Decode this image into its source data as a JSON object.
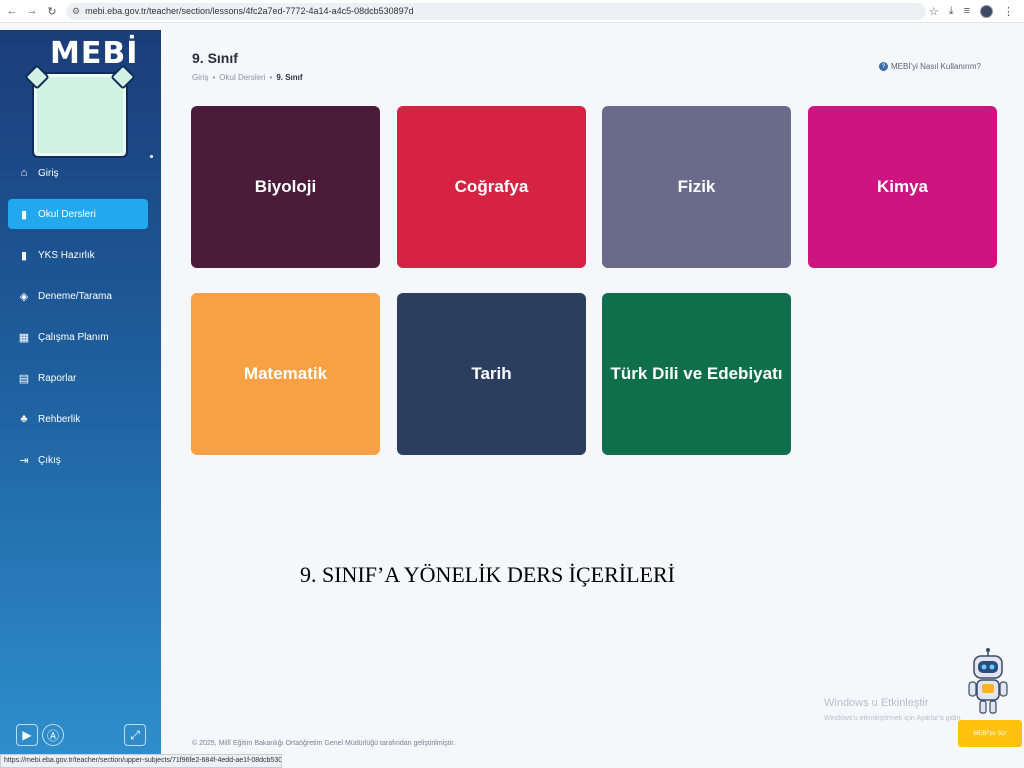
{
  "browser": {
    "url": "mebi.eba.gov.tr/teacher/section/lessons/4fc2a7ed-7772-4a14-a4c5-08dcb530897d",
    "status_url": "https://mebi.eba.gov.tr/teacher/section/upper-subjects/71f96fe2-684f-4edd-ae1f-08dcb530b06b"
  },
  "sidebar": {
    "logo": "MEBİ",
    "items": [
      {
        "label": "Giriş",
        "icon": "home-icon",
        "active": false
      },
      {
        "label": "Okul Dersleri",
        "icon": "book-icon",
        "active": true
      },
      {
        "label": "YKS Hazırlık",
        "icon": "book-icon",
        "active": false
      },
      {
        "label": "Deneme/Tarama",
        "icon": "layers-icon",
        "active": false
      },
      {
        "label": "Çalışma Planım",
        "icon": "calendar-icon",
        "active": false
      },
      {
        "label": "Raporlar",
        "icon": "report-icon",
        "active": false
      },
      {
        "label": "Rehberlik",
        "icon": "people-icon",
        "active": false
      },
      {
        "label": "Çıkış",
        "icon": "logout-icon",
        "active": false
      }
    ]
  },
  "header": {
    "title": "9. Sınıf",
    "breadcrumb": [
      "Giriş",
      "Okul Dersleri",
      "9. Sınıf"
    ],
    "help_link": "MEBİ'yi Nasıl Kullanırım?"
  },
  "subjects": [
    {
      "label": "Biyoloji",
      "color": "#4a1c3a"
    },
    {
      "label": "Coğrafya",
      "color": "#d62344"
    },
    {
      "label": "Fizik",
      "color": "#6a6a8a"
    },
    {
      "label": "Kimya",
      "color": "#cd1481"
    },
    {
      "label": "Matematik",
      "color": "#f7a144"
    },
    {
      "label": "Tarih",
      "color": "#2c3e5e"
    },
    {
      "label": "Türk Dili ve Edebiyatı",
      "color": "#0f6e4c"
    }
  ],
  "caption": "9. SINIF’A YÖNELİK DERS İÇERİLERİ",
  "footer": "© 2025, Millî Eğitim Bakanlığı Ortaöğretim Genel Müdürlüğü tarafından geliştirilmiştir.",
  "watermark": {
    "line1": "Windows u Etkinleştir",
    "line2": "Windows'u etkinleştirmek için Ayarlar'a gidin."
  },
  "assistant_button": "MEBİ'ye Sor"
}
